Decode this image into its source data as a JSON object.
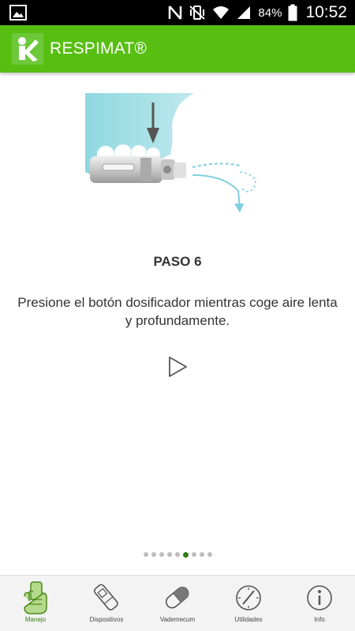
{
  "status_bar": {
    "battery_percent": "84%",
    "time": "10:52",
    "icons": [
      "gallery-icon",
      "nfc-icon",
      "vibrate-icon",
      "wifi-icon",
      "signal-icon",
      "battery-icon"
    ]
  },
  "app_bar": {
    "title": "RESPIMAT®",
    "logo_icon": "app-logo-icon",
    "background_color": "#57bf12"
  },
  "step": {
    "title": "PASO 6",
    "text": "Presione el botón dosificador mientras coge aire lenta y profundamente.",
    "illustration": "respimat-inhaler-illustration",
    "play_icon": "play-icon"
  },
  "pager": {
    "total": 9,
    "current": 6,
    "active_color": "#2e7d12"
  },
  "bottom_nav": {
    "items": [
      {
        "label": "Manejo",
        "icon": "hand-inhaler-icon",
        "active": true
      },
      {
        "label": "Dispositivos",
        "icon": "inhaler-device-icon",
        "active": false
      },
      {
        "label": "Vademecum",
        "icon": "capsule-icon",
        "active": false
      },
      {
        "label": "Utilidades",
        "icon": "gauge-icon",
        "active": false
      },
      {
        "label": "Info",
        "icon": "info-icon",
        "active": false
      }
    ]
  }
}
